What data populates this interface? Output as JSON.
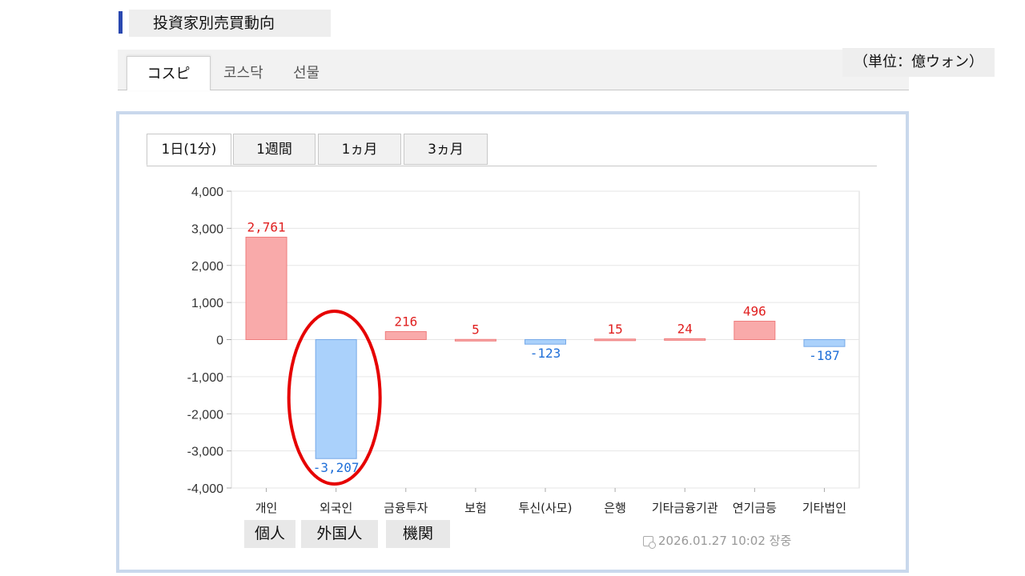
{
  "header": {
    "title": "投資家別売買動向"
  },
  "market_tabs": [
    {
      "label": "コスピ",
      "active": true
    },
    {
      "label": "코스닥",
      "active": false
    },
    {
      "label": "선물",
      "active": false
    }
  ],
  "unit_label": "（単位：億ウォン）",
  "period_tabs": [
    {
      "label": "1日(1分)",
      "active": true
    },
    {
      "label": "1週間",
      "active": false
    },
    {
      "label": "1ヵ月",
      "active": false
    },
    {
      "label": "3ヵ月",
      "active": false
    }
  ],
  "jp_labels": [
    "個人",
    "外国人",
    "機関"
  ],
  "timestamp": "2026.01.27 10:02 장중",
  "colors": {
    "positive": "#f9aaaa",
    "positive_stroke": "#ef7d7d",
    "negative": "#aad1fb",
    "negative_stroke": "#76a9e8",
    "pos_text": "#e02020",
    "neg_text": "#1f6fd8",
    "highlight": "#e60000"
  },
  "chart_data": {
    "type": "bar",
    "categories": [
      "개인",
      "외국인",
      "금융투자",
      "보험",
      "투신(사모)",
      "은행",
      "기타금융기관",
      "연기금등",
      "기타법인"
    ],
    "values": [
      2761,
      -3207,
      216,
      5,
      -123,
      15,
      24,
      496,
      -187
    ],
    "value_labels": [
      "2,761",
      "-3,207",
      "216",
      "5",
      "-123",
      "15",
      "24",
      "496",
      "-187"
    ],
    "ylim": [
      -4000,
      4000
    ],
    "yticks": [
      4000,
      3000,
      2000,
      1000,
      0,
      -1000,
      -2000,
      -3000,
      -4000
    ],
    "ytick_labels": [
      "4,000",
      "3,000",
      "2,000",
      "1,000",
      "0",
      "-1,000",
      "-2,000",
      "-3,000",
      "-4,000"
    ],
    "grid": true,
    "highlighted_category": "외국인",
    "title": "",
    "xlabel": "",
    "ylabel": ""
  }
}
